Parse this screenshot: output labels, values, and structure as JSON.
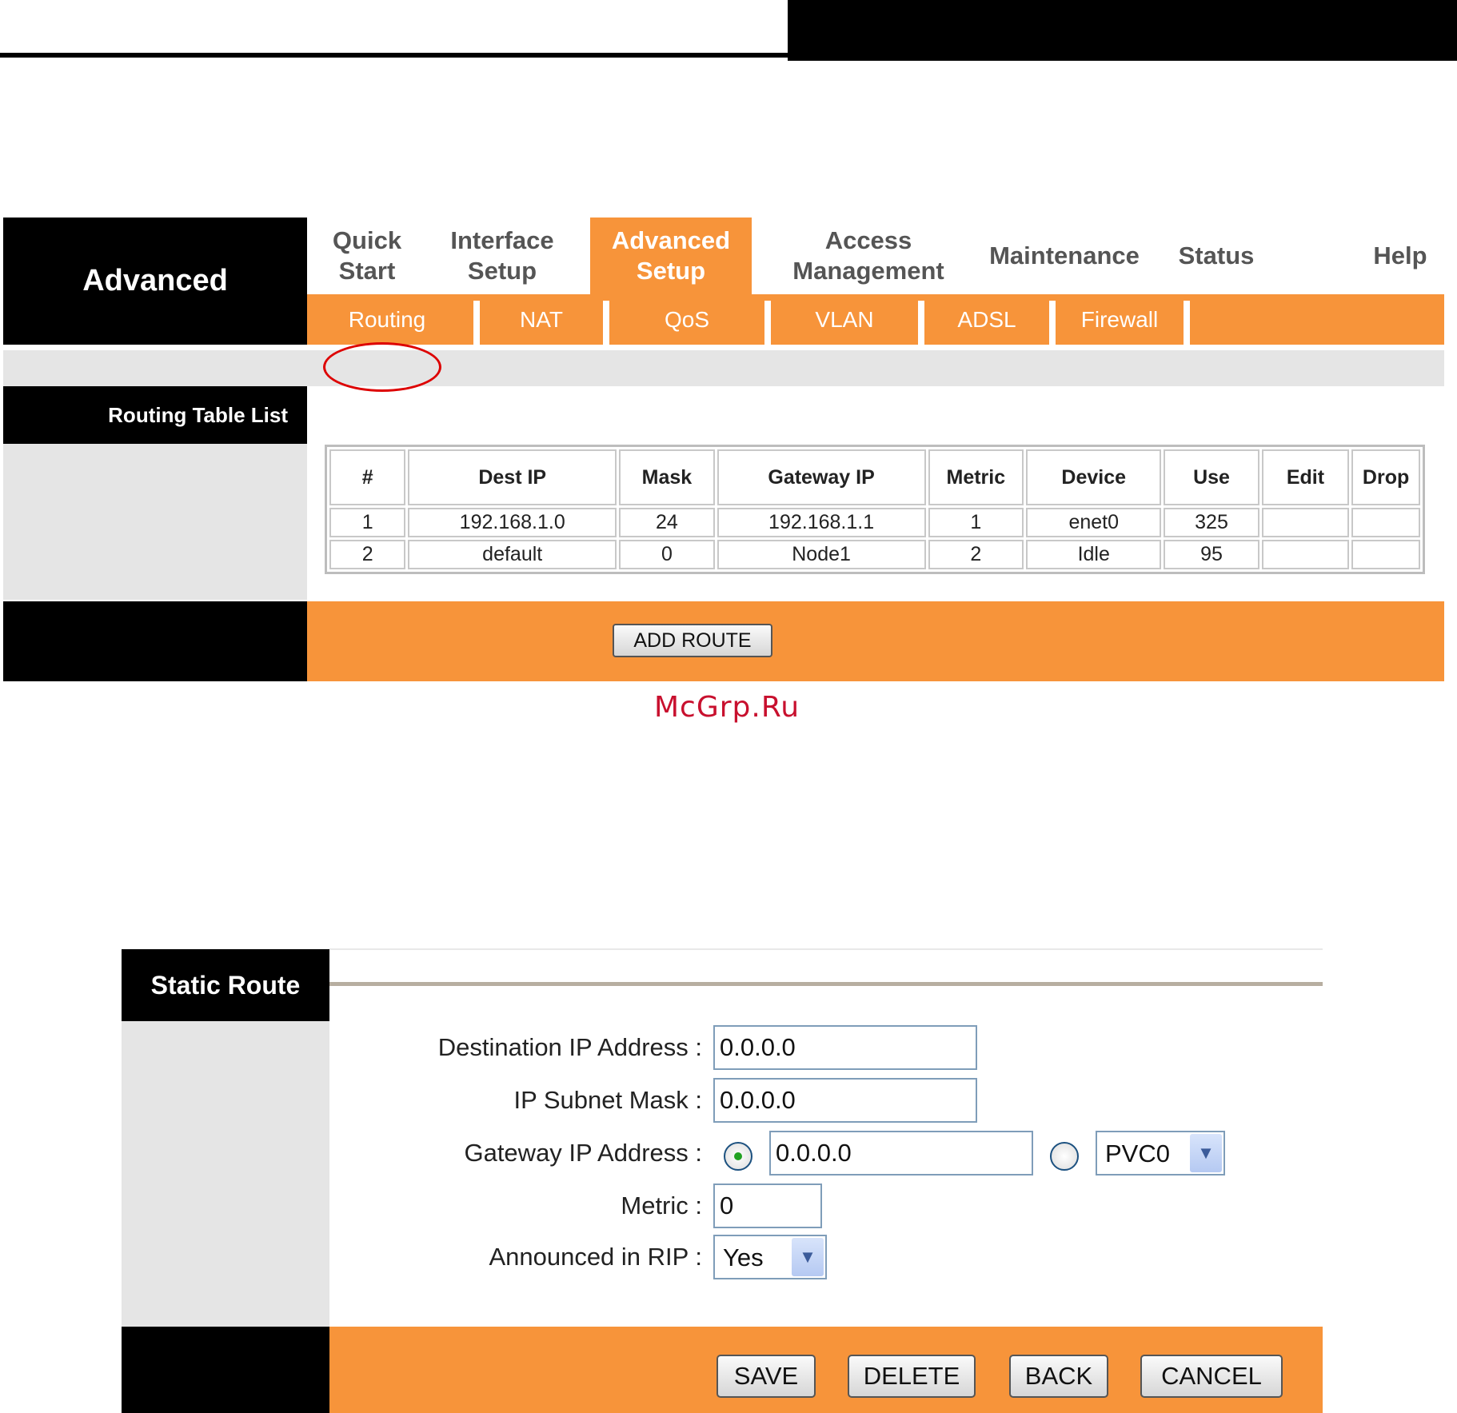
{
  "colors": {
    "accent": "#f7943a",
    "dark": "#000000",
    "panel_gray": "#e5e5e5",
    "annotation": "#dd0000"
  },
  "panel1": {
    "side_title": "Advanced",
    "nav_tabs": [
      {
        "label": "Quick\nStart",
        "active": false
      },
      {
        "label": "Interface\nSetup",
        "active": false
      },
      {
        "label": "Advanced\nSetup",
        "active": true
      },
      {
        "label": "Access\nManagement",
        "active": false
      },
      {
        "label": "Maintenance",
        "active": false
      },
      {
        "label": "Status",
        "active": false
      },
      {
        "label": "Help",
        "active": false
      }
    ],
    "sub_tabs": [
      "Routing",
      "NAT",
      "QoS",
      "VLAN",
      "ADSL",
      "Firewall"
    ],
    "section_label": "Routing Table List",
    "table": {
      "headers": [
        "#",
        "Dest IP",
        "Mask",
        "Gateway IP",
        "Metric",
        "Device",
        "Use",
        "Edit",
        "Drop"
      ],
      "rows": [
        [
          "1",
          "192.168.1.0",
          "24",
          "192.168.1.1",
          "1",
          "enet0",
          "325",
          "",
          ""
        ],
        [
          "2",
          "default",
          "0",
          "Node1",
          "2",
          "Idle",
          "95",
          "",
          ""
        ]
      ]
    },
    "add_route_button": "ADD ROUTE"
  },
  "watermark": "McGrp.Ru",
  "panel2": {
    "title": "Static Route",
    "fields": {
      "dest_ip_label": "Destination IP Address :",
      "dest_ip_value": "0.0.0.0",
      "subnet_label": "IP Subnet Mask :",
      "subnet_value": "0.0.0.0",
      "gateway_label": "Gateway IP Address :",
      "gateway_value": "0.0.0.0",
      "gateway_mode": "ip",
      "pvc_value": "PVC0",
      "metric_label": "Metric :",
      "metric_value": "0",
      "rip_label": "Announced in RIP :",
      "rip_value": "Yes"
    },
    "buttons": {
      "save": "SAVE",
      "delete": "DELETE",
      "back": "BACK",
      "cancel": "CANCEL"
    }
  }
}
